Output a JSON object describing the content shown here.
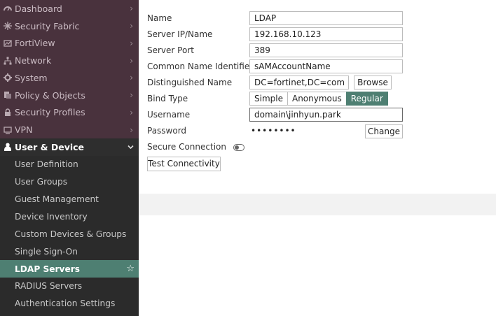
{
  "sidebar": {
    "top_items": [
      {
        "label": "Dashboard",
        "icon": "dashboard-icon"
      },
      {
        "label": "Security Fabric",
        "icon": "security-fabric-icon"
      },
      {
        "label": "FortiView",
        "icon": "fortiview-icon"
      },
      {
        "label": "Network",
        "icon": "network-icon"
      },
      {
        "label": "System",
        "icon": "gear-icon"
      },
      {
        "label": "Policy & Objects",
        "icon": "policy-icon"
      },
      {
        "label": "Security Profiles",
        "icon": "lock-icon"
      },
      {
        "label": "VPN",
        "icon": "monitor-icon"
      }
    ],
    "expanded": {
      "label": "User & Device",
      "icon": "user-icon"
    },
    "sub_items": [
      {
        "label": "User Definition"
      },
      {
        "label": "User Groups"
      },
      {
        "label": "Guest Management"
      },
      {
        "label": "Device Inventory"
      },
      {
        "label": "Custom Devices & Groups"
      },
      {
        "label": "Single Sign-On"
      },
      {
        "label": "LDAP Servers",
        "active": true
      },
      {
        "label": "RADIUS Servers"
      },
      {
        "label": "Authentication Settings"
      }
    ],
    "colors": {
      "top_bg": "#49323d",
      "bottom_bg": "#2b2b2b",
      "accent": "#4e7f72"
    }
  },
  "form": {
    "name": {
      "label": "Name",
      "value": "LDAP"
    },
    "server_ip": {
      "label": "Server IP/Name",
      "value": "192.168.10.123"
    },
    "server_port": {
      "label": "Server Port",
      "value": "389"
    },
    "cn_identifier": {
      "label": "Common Name Identifier",
      "value": "sAMAccountName"
    },
    "distinguished_name": {
      "label": "Distinguished Name",
      "value": "DC=fortinet,DC=com",
      "browse_label": "Browse"
    },
    "bind_type": {
      "label": "Bind Type",
      "options": [
        "Simple",
        "Anonymous",
        "Regular"
      ],
      "selected": "Regular"
    },
    "username": {
      "label": "Username",
      "value": "domain\\jinhyun.park"
    },
    "password": {
      "label": "Password",
      "masked": "••••••••",
      "change_label": "Change"
    },
    "secure_connection": {
      "label": "Secure Connection",
      "enabled": false
    },
    "test_button": "Test Connectivity"
  }
}
